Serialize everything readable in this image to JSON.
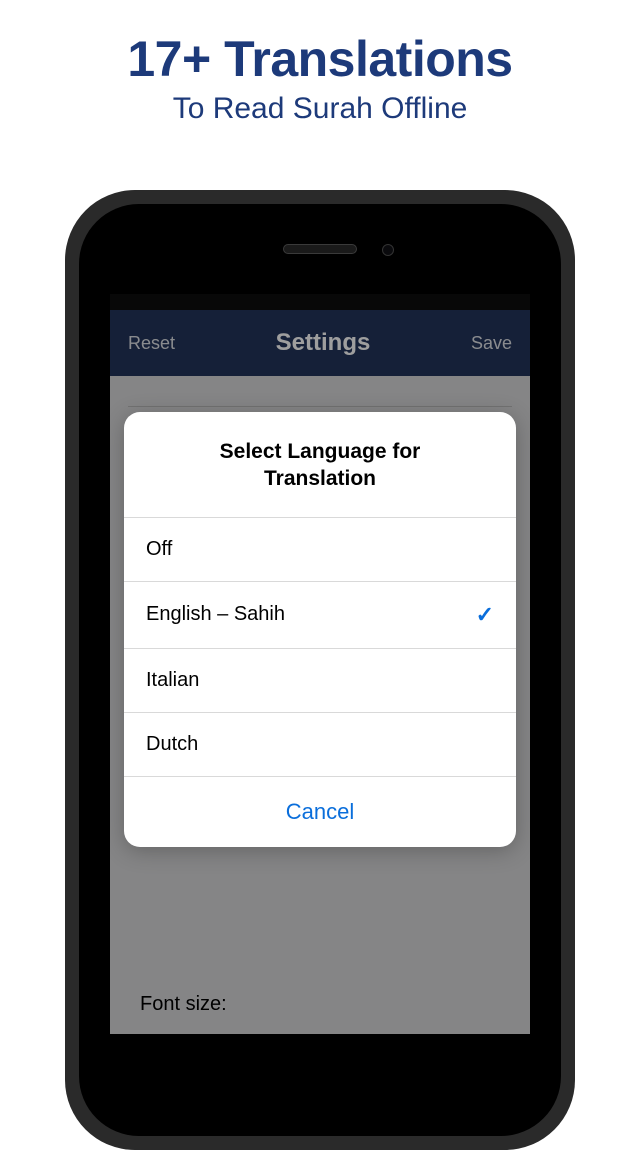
{
  "hero": {
    "title": "17+ Translations",
    "subtitle": "To Read Surah Offline"
  },
  "navbar": {
    "left": "Reset",
    "title": "Settings",
    "right": "Save"
  },
  "background": {
    "font_size_label": "Font size:"
  },
  "sheet": {
    "title": "Select Language for Translation",
    "options": [
      {
        "label": "Off",
        "selected": false
      },
      {
        "label": "English – Sahih",
        "selected": true
      },
      {
        "label": "Italian",
        "selected": false
      },
      {
        "label": "Dutch",
        "selected": false
      }
    ],
    "cancel": "Cancel"
  }
}
